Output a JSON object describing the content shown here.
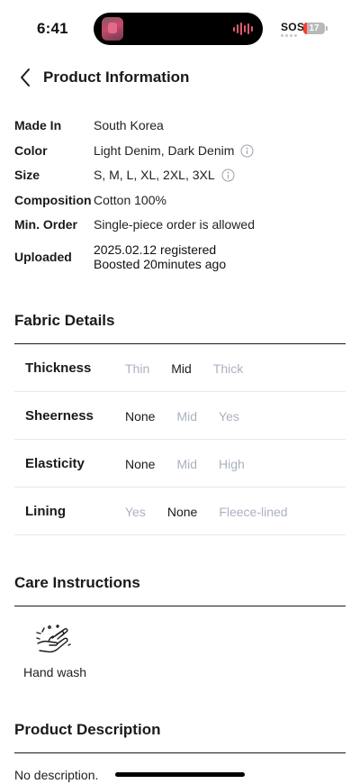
{
  "status_bar": {
    "time": "6:41",
    "sos": "SOS",
    "battery_level": "17",
    "battery_fraction": 0.17,
    "battery_color": "#ff3b30"
  },
  "header": {
    "back_icon": "chevron-left-icon",
    "title": "Product Information"
  },
  "info": {
    "made_in": {
      "label": "Made In",
      "value": "South Korea"
    },
    "color": {
      "label": "Color",
      "value": "Light Denim, Dark Denim",
      "icon": "info-circle-icon"
    },
    "size": {
      "label": "Size",
      "value": "S, M, L, XL, 2XL, 3XL",
      "icon": "info-circle-icon"
    },
    "composition": {
      "label": "Composition",
      "value": "Cotton 100%"
    },
    "min_order": {
      "label": "Min. Order",
      "value": "Single-piece order is allowed"
    },
    "uploaded": {
      "label": "Uploaded",
      "line1": "2025.02.12 registered",
      "line2": "Boosted 20minutes ago"
    }
  },
  "fabric": {
    "title": "Fabric Details",
    "rows": [
      {
        "label": "Thickness",
        "options": [
          "Thin",
          "Mid",
          "Thick"
        ],
        "selected": "Mid"
      },
      {
        "label": "Sheerness",
        "options": [
          "None",
          "Mid",
          "Yes"
        ],
        "selected": "None"
      },
      {
        "label": "Elasticity",
        "options": [
          "None",
          "Mid",
          "High"
        ],
        "selected": "None"
      },
      {
        "label": "Lining",
        "options": [
          "Yes",
          "None",
          "Fleece-lined"
        ],
        "selected": "None"
      }
    ],
    "active_color": "#1a1a1a",
    "inactive_color": "#aab1c0"
  },
  "care": {
    "title": "Care Instructions",
    "items": [
      {
        "icon": "hand-wash-icon",
        "label": "Hand wash"
      }
    ]
  },
  "description": {
    "title": "Product Description",
    "text": "No description."
  }
}
